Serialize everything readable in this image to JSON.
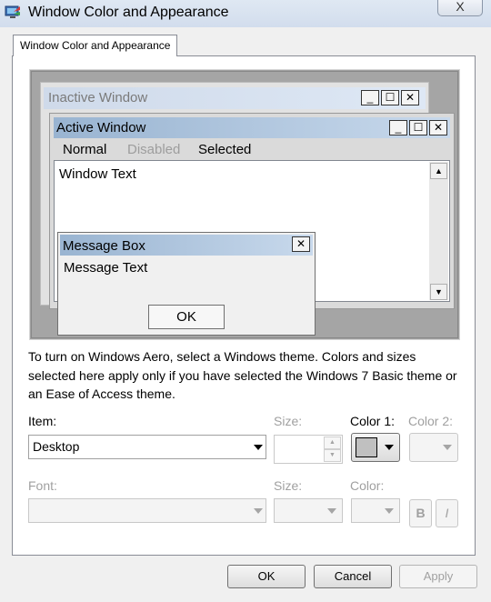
{
  "window": {
    "title": "Window Color and Appearance",
    "close_glyph": "X"
  },
  "tab": {
    "label": "Window Color and Appearance"
  },
  "preview": {
    "inactive_title": "Inactive Window",
    "active_title": "Active Window",
    "menu": {
      "normal": "Normal",
      "disabled": "Disabled",
      "selected": "Selected"
    },
    "window_text": "Window Text",
    "message_box": {
      "title": "Message Box",
      "text": "Message Text",
      "ok_label": "OK"
    },
    "caption_glyphs": {
      "minimize": "_",
      "maximize": "☐",
      "close": "✕"
    }
  },
  "description": "To turn on Windows Aero, select a Windows theme.  Colors and sizes selected here apply only if you have selected the Windows 7 Basic theme or an Ease of Access theme.",
  "item": {
    "label": "Item:",
    "value": "Desktop"
  },
  "item_size": {
    "label": "Size:",
    "value": ""
  },
  "color1": {
    "label": "Color 1:",
    "swatch_color": "#c0c0c0"
  },
  "color2": {
    "label": "Color 2:"
  },
  "font": {
    "label": "Font:",
    "value": ""
  },
  "font_size": {
    "label": "Size:",
    "value": ""
  },
  "font_color": {
    "label": "Color:"
  },
  "bold_label": "B",
  "italic_label": "I",
  "buttons": {
    "ok": "OK",
    "cancel": "Cancel",
    "apply": "Apply"
  }
}
